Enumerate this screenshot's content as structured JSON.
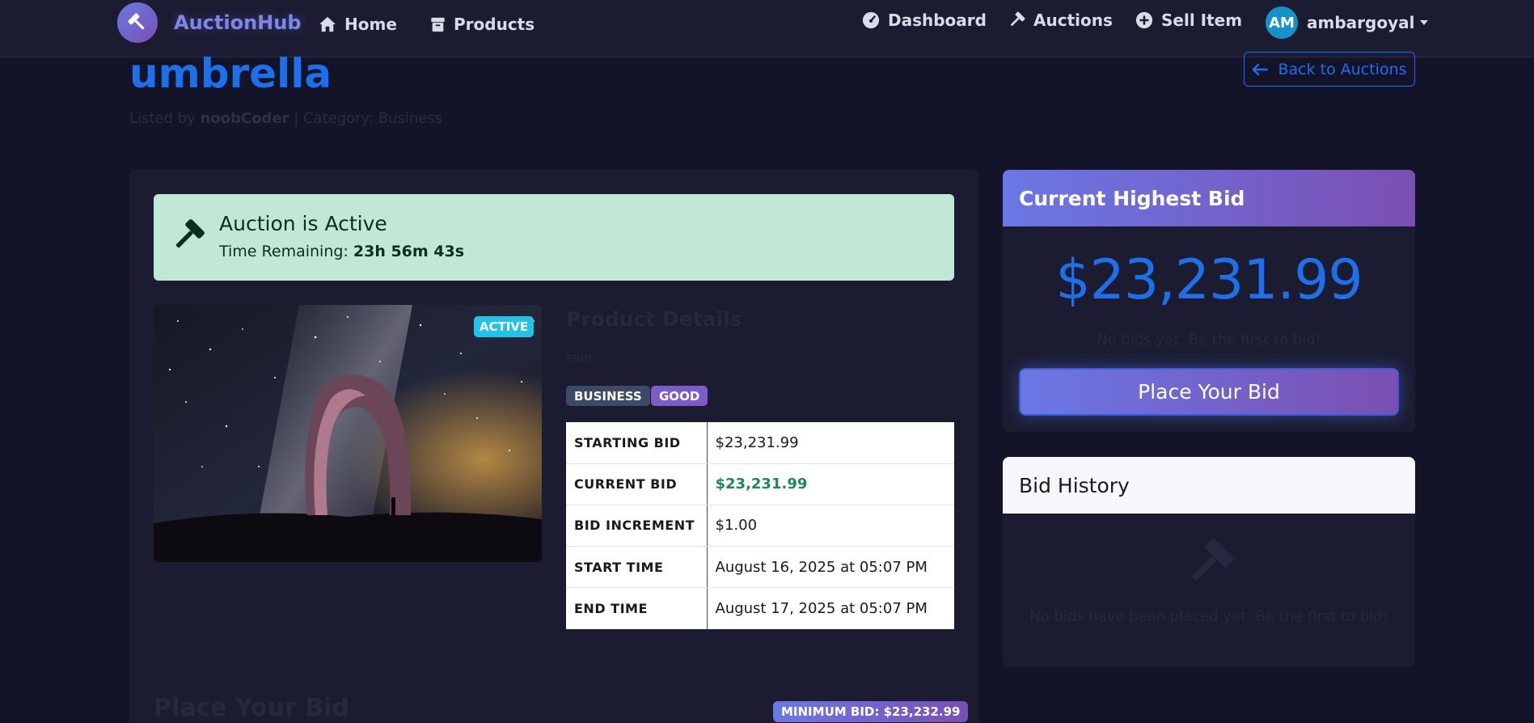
{
  "nav": {
    "brand": "AuctionHub",
    "links": {
      "home": "Home",
      "products": "Products",
      "dashboard": "Dashboard",
      "auctions": "Auctions",
      "sell": "Sell Item"
    },
    "user": {
      "initials": "AM",
      "name": "ambargoyal"
    }
  },
  "header": {
    "title": "umbrella",
    "listed_prefix": "Listed by ",
    "seller": "noobCoder",
    "category_text": " | Category: Business",
    "back_label": "Back to Auctions"
  },
  "alert": {
    "title": "Auction is Active",
    "time_label": "Time Remaining: ",
    "time_value": "23h 56m 43s"
  },
  "product": {
    "status_badge": "ACTIVE",
    "details_heading": "Product Details",
    "description": "rain",
    "tags": [
      "BUSINESS",
      "GOOD"
    ],
    "table": [
      {
        "key": "STARTING BID",
        "value": "$23,231.99"
      },
      {
        "key": "CURRENT BID",
        "value": "$23,231.99"
      },
      {
        "key": "BID INCREMENT",
        "value": "$1.00"
      },
      {
        "key": "START TIME",
        "value": "August 16, 2025 at 05:07 PM"
      },
      {
        "key": "END TIME",
        "value": "August 17, 2025 at 05:07 PM"
      }
    ]
  },
  "place_bid": {
    "heading": "Place Your Bid",
    "min_bid": "MINIMUM BID: $23,232.99"
  },
  "highest_bid": {
    "heading": "Current Highest Bid",
    "amount": "$23,231.99",
    "note": "No bids yet. Be the first to bid!",
    "button": "Place Your Bid"
  },
  "bid_history": {
    "heading": "Bid History",
    "empty": "No bids have been placed yet. Be the first to bid!"
  },
  "colors": {
    "accent": "#1d6fea",
    "gradient_start": "#6a78e6",
    "gradient_end": "#7b4fb2",
    "success_bg": "#c1e8d7",
    "green_value": "#1e8a4f"
  }
}
